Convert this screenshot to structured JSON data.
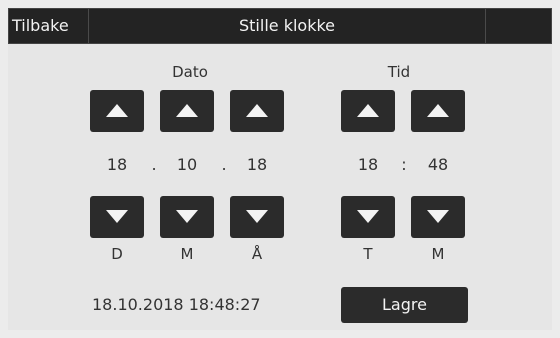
{
  "header": {
    "back_label": "Tilbake",
    "title": "Stille klokke"
  },
  "date": {
    "label": "Dato",
    "day": "18",
    "month": "10",
    "year": "18",
    "separator": ".",
    "units": {
      "day": "D",
      "month": "M",
      "year": "Å"
    }
  },
  "time": {
    "label": "Tid",
    "hour": "18",
    "minute": "48",
    "separator": ":",
    "units": {
      "hour": "T",
      "minute": "M"
    }
  },
  "current_datetime": "18.10.2018 18:48:27",
  "save_label": "Lagre",
  "icons": {
    "increment": "arrow-up-icon",
    "decrement": "arrow-down-icon"
  },
  "colors": {
    "bar": "#232323",
    "button": "#2b2b2b",
    "background": "#e6e6e6"
  }
}
